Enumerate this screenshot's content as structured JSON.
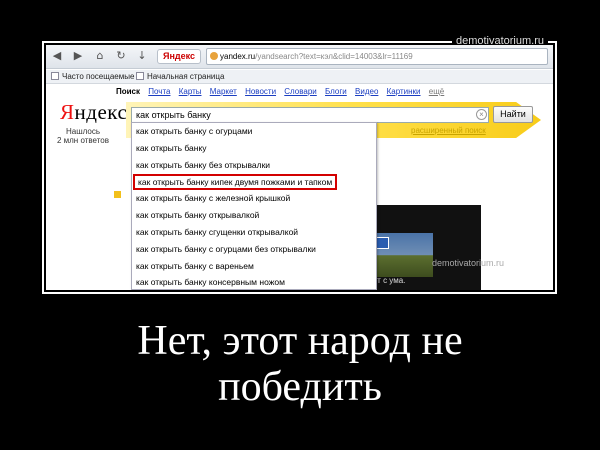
{
  "watermark": "demotivatorium.ru",
  "browser": {
    "nav_icons": [
      "back-icon",
      "forward-icon",
      "home-icon",
      "refresh-icon",
      "download-icon"
    ],
    "tab_label": "Яндекс",
    "url_host": "yandex.ru",
    "url_path": "/yandsearch?text=кэл&clid=14003&lr=11169",
    "bookmarks": [
      "Часто посещаемые",
      "Начальная страница"
    ]
  },
  "yandex": {
    "nav": {
      "current": "Поиск",
      "links": [
        "Почта",
        "Карты",
        "Маркет",
        "Новости",
        "Словари",
        "Блоги",
        "Видео",
        "Картинки"
      ],
      "more": "ещё"
    },
    "logo_first": "Я",
    "logo_rest": "ндекс",
    "found_line1": "Нашлось",
    "found_line2": "2 млн ответов",
    "search_value": "как открыть банку",
    "find_button": "Найти",
    "advanced": "расширенный поиск",
    "suggestions": [
      "как открыть банку с огурцами",
      "как открыть банку",
      "как открыть банку без открывалки",
      "как открыть банку кипек двумя пожками и тапком",
      "как открыть банку с железной крышкой",
      "как открыть банку открывалкой",
      "как открыть банку сгущенки открывалкой",
      "как открыть банку с огурцами без открывалки",
      "как открыть банку с вареньем",
      "как открыть банку консервным ножом"
    ],
    "highlighted_index": 3,
    "image_caption": "ет с ума.",
    "accent_color": "#ffcc00",
    "highlight_color": "#d30000"
  },
  "caption": {
    "line1": "Нет, этот народ не",
    "line2": "победить"
  }
}
